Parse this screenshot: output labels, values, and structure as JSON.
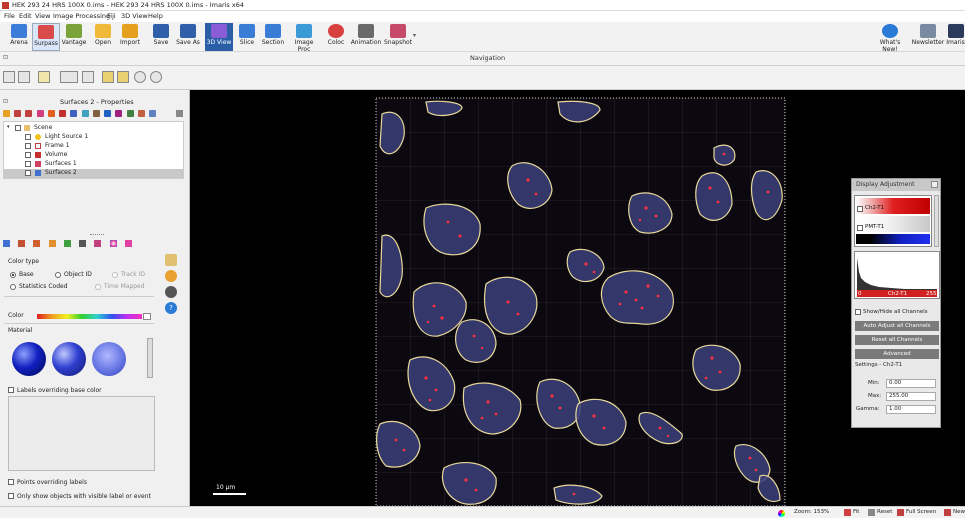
{
  "window": {
    "title": "HEK 293 24 HRS 100X 0.ims - HEK 293 24 HRS 100X 0.ims - Imaris x64"
  },
  "menu": [
    "File",
    "Edit",
    "View",
    "Image Processing",
    "Fiji",
    "3D View",
    "Help"
  ],
  "toolbar": {
    "arena": "Arena",
    "surpass": "Surpass",
    "vantage": "Vantage",
    "open": "Open",
    "import": "Import",
    "save": "Save",
    "save_as": "Save As",
    "view3d": "3D View",
    "slice": "Slice",
    "section": "Section",
    "image_proc": "Image Proc",
    "coloc": "Coloc",
    "animation": "Animation",
    "snapshot": "Snapshot",
    "whats_new": "What's New!",
    "newsletter": "Newsletter",
    "imaris": "Imaris"
  },
  "nav": {
    "title": "Navigation"
  },
  "panel": {
    "title": "Surfaces 2 - Properties",
    "tree": [
      {
        "label": "Scene"
      },
      {
        "label": "Light Source 1"
      },
      {
        "label": "Frame 1"
      },
      {
        "label": "Volume"
      },
      {
        "label": "Surfaces 1"
      },
      {
        "label": "Surfaces 2"
      }
    ],
    "color_type": "Color type",
    "base": "Base",
    "object_id": "Object ID",
    "track_id": "Track ID",
    "stat_coded": "Statistics Coded",
    "time_mapped": "Time Mapped",
    "color": "Color",
    "material": "Material",
    "labels_overriding": "Labels overriding base color",
    "points_overriding": "Points overriding labels",
    "only_show": "Only show objects with visible label or event"
  },
  "viewer": {
    "scale_label": "10 µm"
  },
  "display_adjustment": {
    "title": "Display Adjustment",
    "ch1": "Ch2-T1",
    "ch2": "PMT-T1",
    "hist_min": "0",
    "hist_name": "Ch2-T1",
    "hist_max": "255",
    "show_hide": "Show/Hide all Channels",
    "auto_adjust": "Auto Adjust all Channels",
    "reset": "Reset all Channels",
    "advanced": "Advanced",
    "settings": "Settings - Ch2-T1",
    "min_label": "Min:",
    "min_value": "0.00",
    "max_label": "Max:",
    "max_value": "255.00",
    "gamma_label": "Gamma:",
    "gamma_value": "1.00"
  },
  "status": {
    "zoom": "Zoom: 153%",
    "fit": "Fit",
    "reset": "Reset",
    "full_screen": "Full Screen",
    "new": "New"
  },
  "colors": {
    "accent": "#2a5fa8",
    "cell_outline": "#e8d89a",
    "cell_fill": "#3b3f7a",
    "spot": "#ff3040"
  }
}
